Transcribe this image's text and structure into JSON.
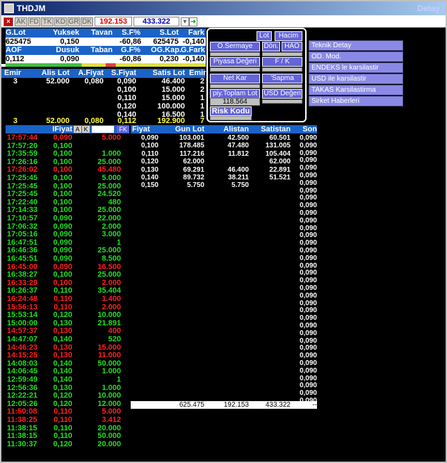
{
  "window": {
    "title": "THDJM",
    "right_label": "Detay"
  },
  "toolbar": {
    "buttons": [
      "AK",
      "FD",
      "TK",
      "KD",
      "GR",
      "DK"
    ],
    "value_red": "192.153",
    "value_blue": "433.322"
  },
  "summary": {
    "h1": [
      "G.Lot",
      "Yuksek",
      "Tavan",
      "S.F%",
      "S.Lot",
      "Fark"
    ],
    "v1": [
      "625475",
      "0,150",
      "",
      "-60,86",
      "625475",
      "-0,140"
    ],
    "h2": [
      "AOF",
      "Dusuk",
      "Taban",
      "G.F%",
      "OG.Kap.",
      "G.Fark"
    ],
    "v2": [
      "0,112",
      "0,090",
      "",
      "-60,86",
      "0,230",
      "-0,140"
    ]
  },
  "depth": {
    "headers": [
      "Emir",
      "Alis Lot",
      "A.Fiyat",
      "S.Fiyat",
      "Satis Lot",
      "Emir"
    ],
    "rows": [
      [
        "3",
        "52.000",
        "0,080",
        "0,090",
        "46.400",
        "2"
      ],
      [
        "",
        "",
        "",
        "0,100",
        "15.000",
        "2"
      ],
      [
        "",
        "",
        "",
        "0,110",
        "15.000",
        "1"
      ],
      [
        "",
        "",
        "",
        "0,120",
        "100.000",
        "1"
      ],
      [
        "",
        "",
        "",
        "0,140",
        "16.500",
        "1"
      ]
    ],
    "total": [
      "3",
      "52.000",
      "0,080",
      "0,112",
      "192.900",
      "7"
    ]
  },
  "panel": {
    "lot": "Lot",
    "hacim": "Hacim",
    "osermaye": "O.Sermaye",
    "don": "Dön.",
    "hao": "HAO",
    "piyasa": "Piyasa Değeri",
    "fk": "F / K",
    "netkar": "Net Kar",
    "sapma": "'Sapma",
    "piytoplam": "piy.Toplam Lot",
    "usd": "USD Değeri",
    "toplam_val": "118.564",
    "risk": "Risk Kodu"
  },
  "menu": [
    "Teknik Detay",
    "OD. Mod.",
    "ENDEKS le karsilastir",
    "USD ile karsilastir",
    "TAKAS Karsilastirma",
    "Sirket Haberleri"
  ],
  "trades": {
    "header": [
      "IFiyat",
      "A",
      "K",
      "FK"
    ],
    "rows": [
      [
        "17:57:44",
        "0,090",
        "5.000",
        "r"
      ],
      [
        "17:57:20",
        "0,100",
        "",
        "g"
      ],
      [
        "17:35:59",
        "0,100",
        "1.000",
        "g"
      ],
      [
        "17:26:16",
        "0,100",
        "25.000",
        "g"
      ],
      [
        "17:26:02",
        "0,100",
        "45.480",
        "r"
      ],
      [
        "17:25:45",
        "0,100",
        "5.000",
        "g"
      ],
      [
        "17:25:45",
        "0,100",
        "25.000",
        "g"
      ],
      [
        "17:25:45",
        "0,100",
        "24.520",
        "g"
      ],
      [
        "17:22:40",
        "0,100",
        "480",
        "g"
      ],
      [
        "17:14:33",
        "0,100",
        "25.000",
        "g"
      ],
      [
        "17:10:57",
        "0,090",
        "22.000",
        "g"
      ],
      [
        "17:06:32",
        "0,090",
        "2.000",
        "g"
      ],
      [
        "17:05:16",
        "0,090",
        "3.000",
        "g"
      ],
      [
        "16:47:51",
        "0,090",
        "1",
        "g"
      ],
      [
        "16:46:36",
        "0,090",
        "25.000",
        "g"
      ],
      [
        "16:45:51",
        "0,090",
        "8.500",
        "g"
      ],
      [
        "16:45:00",
        "0,090",
        "16.500",
        "r"
      ],
      [
        "16:38:27",
        "0,100",
        "25.000",
        "g"
      ],
      [
        "16:33:29",
        "0,100",
        "2.000",
        "r"
      ],
      [
        "16:26:37",
        "0,110",
        "35.404",
        "g"
      ],
      [
        "16:24:48",
        "0,110",
        "1.400",
        "r"
      ],
      [
        "15:56:13",
        "0,110",
        "2.000",
        "r"
      ],
      [
        "15:53:14",
        "0,120",
        "10.000",
        "g"
      ],
      [
        "15:00:00",
        "0,130",
        "21.891",
        "g"
      ],
      [
        "14:57:37",
        "0,130",
        "400",
        "r"
      ],
      [
        "14:47:07",
        "0,140",
        "520",
        "g"
      ],
      [
        "14:46:23",
        "0,130",
        "15.000",
        "r"
      ],
      [
        "14:15:25",
        "0,130",
        "11.000",
        "r"
      ],
      [
        "14:08:03",
        "0,140",
        "50.000",
        "g"
      ],
      [
        "14:06:45",
        "0,140",
        "1.000",
        "g"
      ],
      [
        "12:59:49",
        "0,140",
        "1",
        "g"
      ],
      [
        "12:56:36",
        "0,130",
        "1.000",
        "g"
      ],
      [
        "12:22:21",
        "0,120",
        "10.000",
        "g"
      ],
      [
        "12:05:26",
        "0,120",
        "12.000",
        "g"
      ],
      [
        "11:50:08",
        "0,110",
        "5.000",
        "r"
      ],
      [
        "11:38:25",
        "0,110",
        "3.412",
        "r"
      ],
      [
        "11:38:15",
        "0,110",
        "20.000",
        "g"
      ],
      [
        "11:38:15",
        "0,110",
        "50.000",
        "g"
      ],
      [
        "11:30:37",
        "0,120",
        "20.000",
        "g"
      ]
    ]
  },
  "dist": {
    "headers": [
      "Fiyat",
      "Gun Lot",
      "Alistan",
      "Satistan",
      "Son"
    ],
    "rows": [
      [
        "0,090",
        "103.001",
        "42.500",
        "60.501"
      ],
      [
        "0,100",
        "178.485",
        "47.480",
        "131.005"
      ],
      [
        "0,110",
        "117.216",
        "11.812",
        "105.404"
      ],
      [
        "0,120",
        "62.000",
        "",
        "62.000"
      ],
      [
        "0,130",
        "69.291",
        "46.400",
        "22.891"
      ],
      [
        "0,140",
        "89.732",
        "38.211",
        "51.521"
      ],
      [
        "0,150",
        "5.750",
        "5.750",
        ""
      ]
    ],
    "son": "0,090",
    "son_count": 36,
    "totals": [
      "625.475",
      "192.153",
      "433.322",
      "--"
    ]
  },
  "colors": {
    "accent": "#1a63c8",
    "red": "#ff2020",
    "green": "#20e020"
  }
}
